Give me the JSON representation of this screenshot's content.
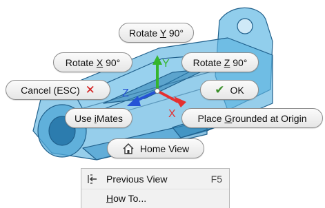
{
  "buttons": {
    "rotate_y": {
      "pre": "Rotate ",
      "key": "Y",
      "post": " 90°"
    },
    "rotate_x": {
      "pre": "Rotate ",
      "key": "X",
      "post": " 90°"
    },
    "rotate_z": {
      "pre": "Rotate ",
      "key": "Z",
      "post": " 90°"
    },
    "cancel": "Cancel (ESC)",
    "ok": "OK",
    "use_imates": {
      "pre": "Use ",
      "key": "i",
      "post": "Mates"
    },
    "place_grounded": {
      "pre": "Place ",
      "key": "G",
      "post": "rounded at Origin"
    },
    "home_view": "Home View"
  },
  "axes": {
    "x": "X",
    "y": "Y",
    "z": "Z"
  },
  "context_menu": {
    "previous_view": {
      "label": "Previous View",
      "shortcut": "F5"
    },
    "how_to": {
      "key": "H",
      "post": "ow To..."
    }
  },
  "colors": {
    "part_fill": "#5eb3e0",
    "part_edge": "#1f5f8b",
    "x_axis": "#e53030",
    "y_axis": "#35b52e",
    "z_axis": "#2553d6",
    "cancel_x": "#d42020",
    "ok_check": "#3a8f2a"
  },
  "icons": {
    "cancel": "close-icon",
    "ok": "checkmark-icon",
    "home": "home-icon",
    "previous_view": "previous-view-icon"
  }
}
